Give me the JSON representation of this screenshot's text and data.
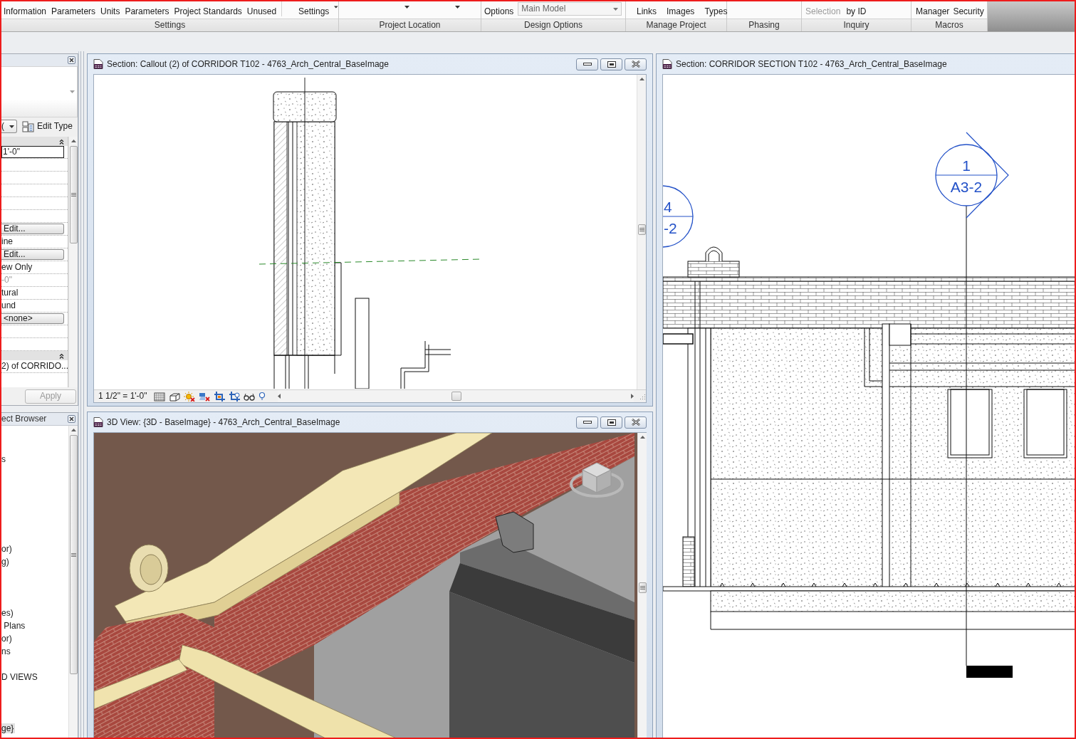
{
  "ribbon": {
    "panels": [
      {
        "title": "Settings",
        "buttons": [
          {
            "kind": "button",
            "label": "Information"
          },
          {
            "kind": "button",
            "label": "Parameters"
          },
          {
            "kind": "button",
            "label": "Units"
          },
          {
            "kind": "button",
            "label": "Parameters"
          },
          {
            "kind": "button",
            "label": "Project Standards"
          },
          {
            "kind": "button",
            "label": "Unused"
          },
          {
            "kind": "split",
            "label": "Settings"
          }
        ]
      },
      {
        "title": "Project Location",
        "buttons": [
          {
            "kind": "caret"
          },
          {
            "kind": "caret"
          }
        ]
      },
      {
        "title": "Design Options",
        "buttons": [
          {
            "kind": "button",
            "label": "Options"
          },
          {
            "kind": "dropdown",
            "value": "Main Model"
          }
        ]
      },
      {
        "title": "Manage Project",
        "buttons": [
          {
            "kind": "button",
            "label": "Links"
          },
          {
            "kind": "button",
            "label": "Images"
          },
          {
            "kind": "button",
            "label": "Types"
          }
        ]
      },
      {
        "title": "Phasing"
      },
      {
        "title": "Inquiry",
        "buttons": [
          {
            "kind": "button",
            "label": "Selection",
            "disabled": true
          },
          {
            "kind": "button",
            "label": "by ID",
            "disabled": false
          }
        ]
      },
      {
        "title": "Macros",
        "buttons": [
          {
            "kind": "button",
            "label": "Manager"
          },
          {
            "kind": "button",
            "label": "Security"
          }
        ]
      }
    ]
  },
  "properties": {
    "filter_value": "(",
    "edit_type": "Edit Type",
    "groups": [
      {
        "rows": [
          {
            "kind": "input",
            "value": "1'-0\"",
            "disabled": false
          },
          {
            "kind": "empty"
          },
          {
            "kind": "empty"
          },
          {
            "kind": "empty"
          },
          {
            "kind": "empty"
          },
          {
            "kind": "empty"
          },
          {
            "kind": "button",
            "value": "Edit...",
            "disabled": false
          },
          {
            "kind": "text",
            "value": "ine",
            "disabled": false
          },
          {
            "kind": "button",
            "value": "Edit...",
            "disabled": false
          },
          {
            "kind": "text",
            "value": "ew Only",
            "disabled": false
          },
          {
            "kind": "text",
            "value": "-0\"",
            "disabled": true
          },
          {
            "kind": "text",
            "value": "tural",
            "disabled": false
          },
          {
            "kind": "text",
            "value": "und",
            "disabled": false
          },
          {
            "kind": "button",
            "value": "<none>",
            "disabled": false
          },
          {
            "kind": "empty"
          },
          {
            "kind": "empty"
          }
        ]
      },
      {
        "rows": [
          {
            "kind": "text",
            "value": "2) of CORRIDO...",
            "disabled": false
          }
        ]
      }
    ],
    "apply": {
      "label": "Apply",
      "disabled": true
    }
  },
  "project_browser": {
    "title": "ect Browser",
    "items": [
      {
        "label": "s",
        "selected": false
      },
      {
        "label": "or)",
        "selected": false
      },
      {
        "label": "g)",
        "selected": false
      },
      {
        "label": "es)",
        "selected": false
      },
      {
        "label": " Plans",
        "selected": false
      },
      {
        "label": "or)",
        "selected": false
      },
      {
        "label": "ns",
        "selected": false
      },
      {
        "label": "D VIEWS",
        "selected": false
      },
      {
        "label": "ge}",
        "selected": true
      }
    ]
  },
  "views": [
    {
      "kind": "callout",
      "title": "Section: Callout (2) of CORRIDOR T102 - 4763_Arch_Central_BaseImage",
      "scale": "1 1/2\" = 1'-0\""
    },
    {
      "kind": "model3d",
      "title": "3D View: {3D - BaseImage} - 4763_Arch_Central_BaseImage"
    },
    {
      "kind": "section",
      "title": "Section: CORRIDOR SECTION T102 - 4763_Arch_Central_BaseImage",
      "markers": [
        {
          "number": "1",
          "sheet": "A3-2"
        },
        {
          "number": "4",
          "sheet": "-2"
        }
      ]
    }
  ]
}
